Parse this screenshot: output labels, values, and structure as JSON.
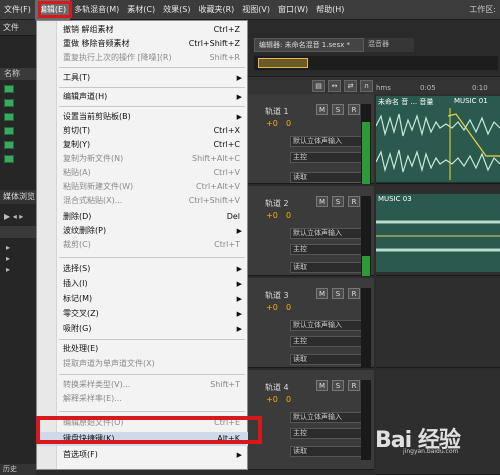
{
  "menubar": {
    "items": [
      "文件(F)",
      "编辑(E)",
      "多轨混音(M)",
      "素材(C)",
      "效果(S)",
      "收藏夹(R)",
      "视图(V)",
      "窗口(W)",
      "帮助(H)"
    ],
    "workspace": "工作区:"
  },
  "left_panel": {
    "tab": "文件",
    "column": "名称",
    "media_tab": "媒体浏览",
    "bottom_tab": "历史"
  },
  "editor": {
    "tab": "编辑器: 未命名混音 1.sesx *",
    "tab2": "混音器"
  },
  "ruler": {
    "unit": "hms",
    "t1": "0:05",
    "t2": "0:10"
  },
  "tracks": [
    {
      "name": "轨道 1",
      "gain": "+0",
      "gain_value": "0",
      "input": "默认立体声输入",
      "output": "主控",
      "read": "读取",
      "clip": "未命名 音 ... 音量",
      "clip2": "MUSIC 01"
    },
    {
      "name": "轨道 2",
      "gain": "+0",
      "gain_value": "0",
      "input": "默认立体声输入",
      "output": "主控",
      "read": "读取",
      "clip": "MUSIC 03"
    },
    {
      "name": "轨道 3",
      "gain": "+0",
      "gain_value": "0",
      "input": "默认立体声输入",
      "output": "主控",
      "read": "读取"
    },
    {
      "name": "轨道 4",
      "gain": "+0",
      "gain_value": "0",
      "input": "默认立体声输入",
      "output": "主控",
      "read": "读取"
    }
  ],
  "edit_menu": {
    "items": [
      {
        "label": "撤销 解组素材",
        "shortcut": "Ctrl+Z"
      },
      {
        "label": "重做 移除音频素材",
        "shortcut": "Ctrl+Shift+Z"
      },
      {
        "label": "重复执行上次的操作 [降噪](R)",
        "shortcut": "Shift+R"
      },
      {
        "label": "工具(T)"
      },
      {
        "label": "编辑声道(H)"
      },
      {
        "label": "设置当前剪贴板(B)"
      },
      {
        "label": "剪切(T)",
        "shortcut": "Ctrl+X"
      },
      {
        "label": "复制(Y)",
        "shortcut": "Ctrl+C"
      },
      {
        "label": "复制为新文件(N)",
        "shortcut": "Shift+Alt+C"
      },
      {
        "label": "粘贴(A)",
        "shortcut": "Ctrl+V"
      },
      {
        "label": "粘贴到新建文件(W)",
        "shortcut": "Ctrl+Alt+V"
      },
      {
        "label": "混合式粘贴(X)...",
        "shortcut": "Ctrl+Shift+V"
      },
      {
        "label": "删除(D)",
        "shortcut": "Del"
      },
      {
        "label": "波纹删除(P)"
      },
      {
        "label": "裁剪(C)",
        "shortcut": "Ctrl+T"
      },
      {
        "label": "选择(S)"
      },
      {
        "label": "插入(I)"
      },
      {
        "label": "标记(M)"
      },
      {
        "label": "零交叉(Z)"
      },
      {
        "label": "吸附(G)"
      },
      {
        "label": "批处理(E)"
      },
      {
        "label": "提取声道为单声道文件(X)"
      },
      {
        "label": "转换采样类型(V)...",
        "shortcut": "Shift+T"
      },
      {
        "label": "解释采样率(E)..."
      },
      {
        "label": "编辑原始文件(O)",
        "shortcut": "Ctrl+E"
      },
      {
        "label": "键盘快捷键(K)...",
        "shortcut": "Alt+K"
      },
      {
        "label": "首选项(F)"
      }
    ]
  },
  "watermark": {
    "text": "Bai 经验",
    "sub": "jingyan.baidu.com"
  }
}
